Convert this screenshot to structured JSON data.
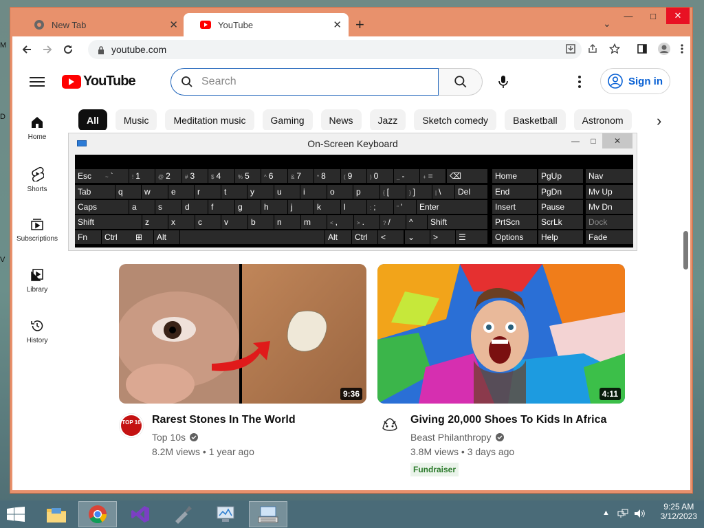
{
  "desktop": {
    "edge_labels": [
      "M",
      "D",
      "V"
    ]
  },
  "browser": {
    "tabs": [
      {
        "title": "New Tab",
        "active": false
      },
      {
        "title": "YouTube",
        "active": true
      }
    ],
    "new_tab_symbol": "+",
    "tab_search_symbol": "⌄",
    "window_controls": {
      "minimize": "—",
      "maximize": "□",
      "close": "✕"
    },
    "address": "youtube.com"
  },
  "youtube": {
    "logo_text": "YouTube",
    "search_placeholder": "Search",
    "signin_label": "Sign in",
    "guide": [
      {
        "label": "Home",
        "icon": "home-icon"
      },
      {
        "label": "Shorts",
        "icon": "shorts-icon"
      },
      {
        "label": "Subscriptions",
        "icon": "subscriptions-icon"
      },
      {
        "label": "Library",
        "icon": "library-icon"
      },
      {
        "label": "History",
        "icon": "history-icon"
      }
    ],
    "chips": [
      "All",
      "Music",
      "Meditation music",
      "Gaming",
      "News",
      "Jazz",
      "Sketch comedy",
      "Basketball",
      "Astronom"
    ],
    "videos": [
      {
        "title": "Rarest Stones In The World",
        "channel": "Top 10s",
        "views": "8.2M views",
        "age": "1 year ago",
        "duration": "9:36",
        "badge": "",
        "avatar_text": "TOP 10"
      },
      {
        "title": "Giving 20,000 Shoes To Kids In Africa",
        "channel": "Beast Philanthropy",
        "views": "3.8M views",
        "age": "3 days ago",
        "duration": "4:11",
        "badge": "Fundraiser",
        "avatar_text": ""
      }
    ]
  },
  "osk": {
    "title": "On-Screen Keyboard",
    "controls": {
      "minimize": "—",
      "maximize": "□",
      "close": "✕"
    },
    "rows": [
      [
        {
          "t": "Esc"
        },
        {
          "s": "~",
          "t": "`"
        },
        {
          "s": "!",
          "t": "1"
        },
        {
          "s": "@",
          "t": "2"
        },
        {
          "s": "#",
          "t": "3"
        },
        {
          "s": "$",
          "t": "4"
        },
        {
          "s": "%",
          "t": "5"
        },
        {
          "s": "^",
          "t": "6"
        },
        {
          "s": "&",
          "t": "7"
        },
        {
          "s": "*",
          "t": "8"
        },
        {
          "s": "(",
          "t": "9"
        },
        {
          "s": ")",
          "t": "0"
        },
        {
          "s": "_",
          "t": "-"
        },
        {
          "s": "+",
          "t": "="
        },
        {
          "t": "⌫"
        },
        {
          "t": "Home"
        },
        {
          "t": "PgUp"
        },
        {
          "t": "Nav"
        }
      ],
      [
        {
          "t": "Tab"
        },
        {
          "t": "q"
        },
        {
          "t": "w"
        },
        {
          "t": "e"
        },
        {
          "t": "r"
        },
        {
          "t": "t"
        },
        {
          "t": "y"
        },
        {
          "t": "u"
        },
        {
          "t": "i"
        },
        {
          "t": "o"
        },
        {
          "t": "p"
        },
        {
          "s": "{",
          "t": "["
        },
        {
          "s": "}",
          "t": "]"
        },
        {
          "s": "|",
          "t": "\\"
        },
        {
          "t": "Del"
        },
        {
          "t": "End"
        },
        {
          "t": "PgDn"
        },
        {
          "t": "Mv Up"
        }
      ],
      [
        {
          "t": "Caps"
        },
        {
          "t": "a"
        },
        {
          "t": "s"
        },
        {
          "t": "d"
        },
        {
          "t": "f"
        },
        {
          "t": "g"
        },
        {
          "t": "h"
        },
        {
          "t": "j"
        },
        {
          "t": "k"
        },
        {
          "t": "l"
        },
        {
          "s": ":",
          "t": ";"
        },
        {
          "s": "\"",
          "t": "'"
        },
        {
          "t": "Enter"
        },
        {
          "t": "Insert"
        },
        {
          "t": "Pause"
        },
        {
          "t": "Mv Dn"
        }
      ],
      [
        {
          "t": "Shift"
        },
        {
          "t": "z"
        },
        {
          "t": "x"
        },
        {
          "t": "c"
        },
        {
          "t": "v"
        },
        {
          "t": "b"
        },
        {
          "t": "n"
        },
        {
          "t": "m"
        },
        {
          "s": "<",
          "t": ","
        },
        {
          "s": ">",
          "t": "."
        },
        {
          "s": "?",
          "t": "/"
        },
        {
          "t": "^"
        },
        {
          "t": "Shift"
        },
        {
          "t": "PrtScn"
        },
        {
          "t": "ScrLk"
        },
        {
          "t": "Dock"
        }
      ],
      [
        {
          "t": "Fn"
        },
        {
          "t": "Ctrl"
        },
        {
          "t": "⊞"
        },
        {
          "t": "Alt"
        },
        {
          "t": ""
        },
        {
          "t": "Alt"
        },
        {
          "t": "Ctrl"
        },
        {
          "t": "<"
        },
        {
          "t": "⌄"
        },
        {
          "t": ">"
        },
        {
          "t": "☰"
        },
        {
          "t": "Options"
        },
        {
          "t": "Help"
        },
        {
          "t": "Fade"
        }
      ]
    ]
  },
  "taskbar": {
    "apps": [
      "file-explorer-icon",
      "chrome-icon",
      "visual-studio-icon",
      "tool-icon",
      "control-panel-icon",
      "on-screen-keyboard-icon"
    ],
    "time": "9:25 AM",
    "date": "3/12/2023"
  },
  "colors": {
    "youtube_red": "#ff0000",
    "link_blue": "#065fd4",
    "window_frame": "#e8916c"
  }
}
